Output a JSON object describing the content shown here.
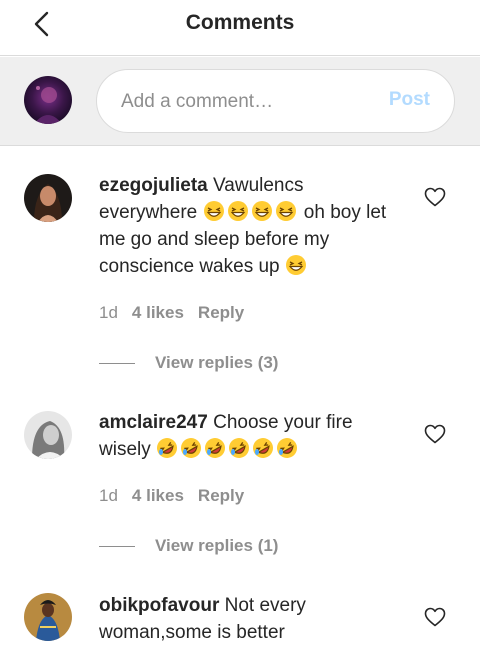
{
  "header": {
    "title": "Comments",
    "back_icon": "chevron-left-icon"
  },
  "composer": {
    "placeholder": "Add a comment…",
    "value": "",
    "post_label": "Post",
    "post_color": "#b3dbff"
  },
  "comments": [
    {
      "username": "ezegojulieta",
      "text_1": "Vawulencs everywhere ",
      "emoji_1": [
        "grinning-squinting-face",
        "grinning-squinting-face",
        "grinning-squinting-face",
        "grinning-squinting-face"
      ],
      "text_2": " oh boy let me go and sleep before my conscience wakes up ",
      "emoji_2": [
        "grinning-squinting-face"
      ],
      "age": "1d",
      "likes": "4 likes",
      "reply_label": "Reply",
      "view_replies": "View replies (3)"
    },
    {
      "username": "amclaire247",
      "text_1": "Choose your fire wisely ",
      "emoji_1": [
        "rolling-on-floor-laughing-face",
        "rolling-on-floor-laughing-face",
        "rolling-on-floor-laughing-face",
        "rolling-on-floor-laughing-face",
        "rolling-on-floor-laughing-face",
        "rolling-on-floor-laughing-face"
      ],
      "age": "1d",
      "likes": "4 likes",
      "reply_label": "Reply",
      "view_replies": "View replies (1)"
    },
    {
      "username": "obikpofavour",
      "text_1": "Not every woman,some is better"
    }
  ],
  "colors": {
    "text": "#262626",
    "secondary": "#8e8e8e",
    "divider": "#dbdbdb",
    "composer_bg": "#efefef"
  }
}
